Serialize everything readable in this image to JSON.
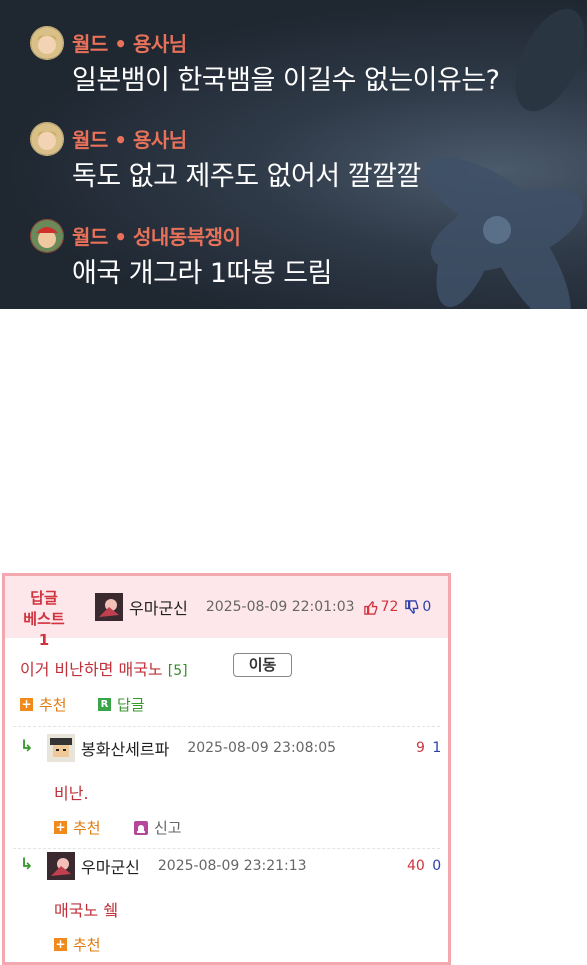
{
  "chat": {
    "messages": [
      {
        "name": "월드 • 용사님",
        "text": "일본뱀이 한국뱀을 이길수 없는이유는?"
      },
      {
        "name": "월드 • 용사님",
        "text": "독도 없고 제주도 없어서 깔깔깔"
      },
      {
        "name": "월드 • 성내동북쟁이",
        "text": "애국 개그라 1따봉 드림"
      }
    ]
  },
  "best": {
    "label_line1": "답글",
    "label_line2": "베스트1",
    "user": "우마군신",
    "date": "2025-08-09 22:01:03",
    "up": "72",
    "down": "0",
    "text": "이거 비난하면 매국노",
    "count": "[5]",
    "move_label": "이동",
    "recommend_label": "추천",
    "reply_label": "답글"
  },
  "replies": [
    {
      "user": "봉화산세르파",
      "date": "2025-08-09 23:08:05",
      "up": "9",
      "down": "1",
      "text": "비난.",
      "recommend_label": "추천",
      "report_label": "신고"
    },
    {
      "user": "우마군신",
      "date": "2025-08-09 23:21:13",
      "up": "40",
      "down": "0",
      "text": "매국노 쉨",
      "recommend_label": "추천"
    }
  ],
  "colors": {
    "accent": "#d0343f",
    "border": "#f2a8ae",
    "name": "#e8715a"
  }
}
